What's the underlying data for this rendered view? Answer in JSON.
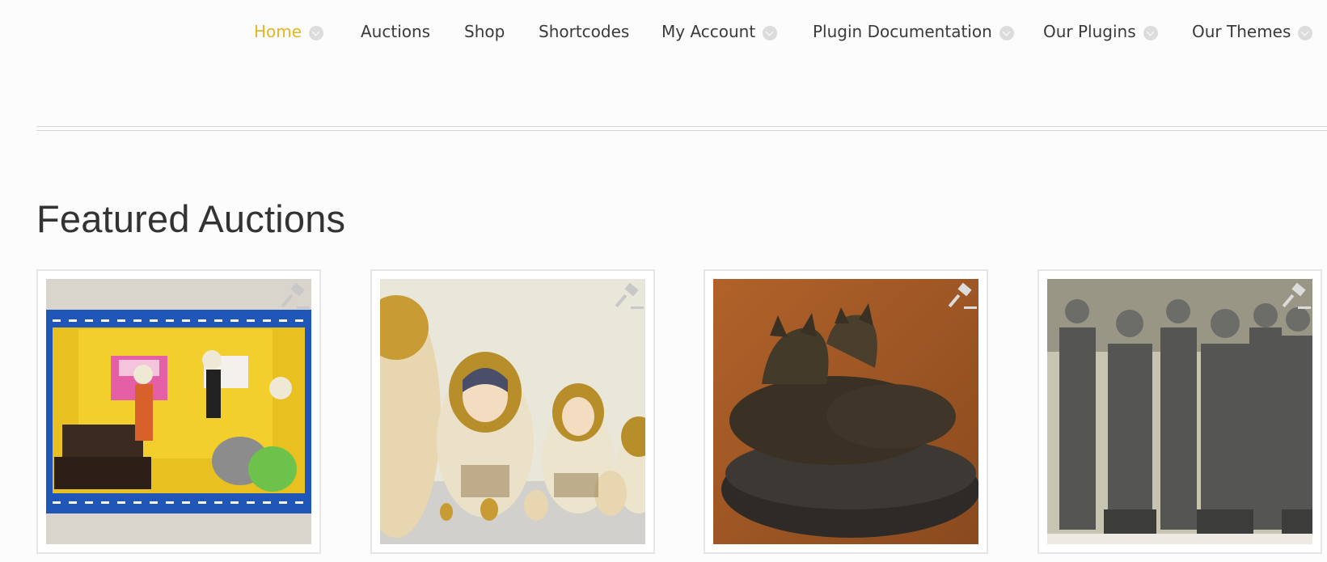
{
  "nav": {
    "items": [
      {
        "label": "Home",
        "active": true,
        "has_dropdown": true
      },
      {
        "label": "Auctions",
        "active": false,
        "has_dropdown": false
      },
      {
        "label": "Shop",
        "active": false,
        "has_dropdown": false
      },
      {
        "label": "Shortcodes",
        "active": false,
        "has_dropdown": false
      },
      {
        "label": "My Account",
        "active": false,
        "has_dropdown": true
      },
      {
        "label": "Plugin Documentation",
        "active": false,
        "has_dropdown": true
      },
      {
        "label": "Our Plugins",
        "active": false,
        "has_dropdown": true
      },
      {
        "label": "Our Themes",
        "active": false,
        "has_dropdown": true
      }
    ],
    "active_color": "#e2b623",
    "text_color": "#3a3a3a"
  },
  "section": {
    "title": "Featured Auctions"
  },
  "auctions": [
    {
      "image": "day-of-the-dead-diorama",
      "badge_icon": "auction-gavel-icon"
    },
    {
      "image": "matryoshka-nesting-dolls",
      "badge_icon": "auction-gavel-icon"
    },
    {
      "image": "bronze-wolf-sculpture",
      "badge_icon": "auction-gavel-icon"
    },
    {
      "image": "terracotta-warrior-figurines",
      "badge_icon": "auction-gavel-icon"
    }
  ]
}
